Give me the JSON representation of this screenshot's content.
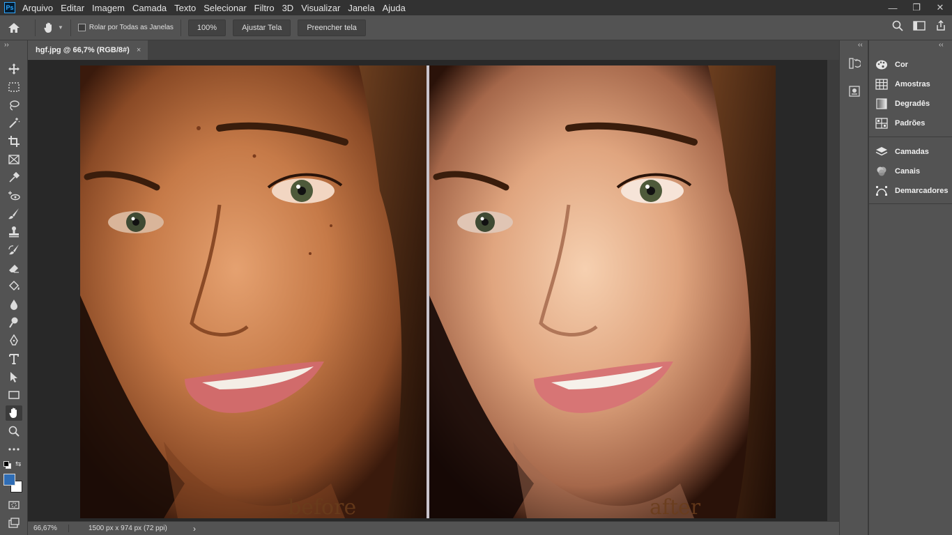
{
  "app": {
    "logo_text": "Ps"
  },
  "menu": [
    "Arquivo",
    "Editar",
    "Imagem",
    "Camada",
    "Texto",
    "Selecionar",
    "Filtro",
    "3D",
    "Visualizar",
    "Janela",
    "Ajuda"
  ],
  "window_controls": {
    "minimize": "—",
    "restore": "❐",
    "close": "✕"
  },
  "options": {
    "scroll_all_label": "Rolar por Todas as Janelas",
    "zoom_value": "100%",
    "fit_screen": "Ajustar Tela",
    "fill_screen": "Preencher tela"
  },
  "document": {
    "tab_title": "hgf.jpg @ 66,7% (RGB/8#)",
    "close": "×",
    "label_before": "before",
    "label_after": "after"
  },
  "status": {
    "zoom": "66,67%",
    "info": "1500 px x 974 px (72 ppi)",
    "arrow": "›"
  },
  "panels": {
    "group1": [
      "Cor",
      "Amostras",
      "Degradês",
      "Padrões"
    ],
    "group2": [
      "Camadas",
      "Canais",
      "Demarcadores"
    ]
  },
  "colors": {
    "foreground": "#2f6db5",
    "background": "#ffffff",
    "accent": "#31a8ff"
  }
}
